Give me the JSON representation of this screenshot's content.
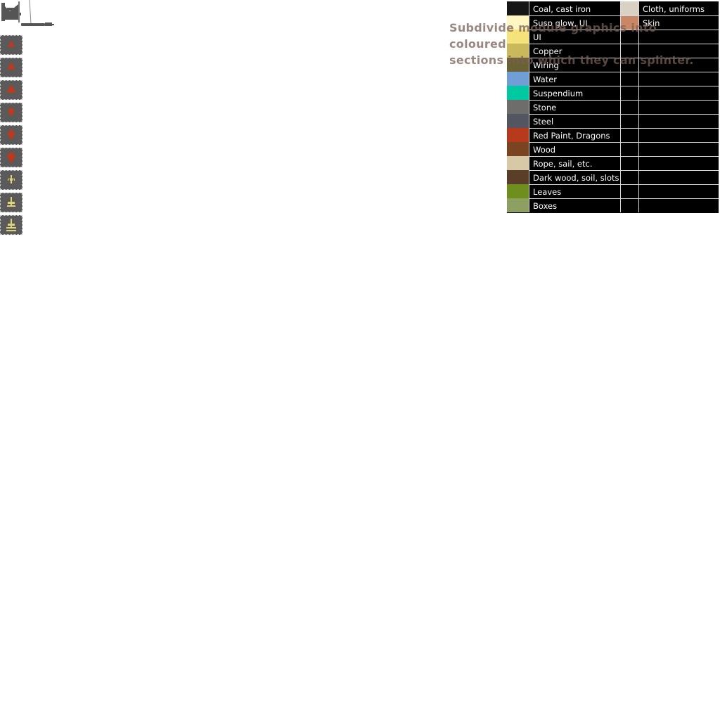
{
  "caption": {
    "line1": "Subdivide module graphics into coloured",
    "line2": "sections into which they can splinter."
  },
  "tools": [
    {
      "icon": "triangle-small-icon",
      "color": "#b83a20"
    },
    {
      "icon": "triangle-medium-icon",
      "color": "#b83a20"
    },
    {
      "icon": "triangle-large-icon",
      "color": "#b83a20"
    },
    {
      "icon": "blob-small-icon",
      "color": "#b83a20"
    },
    {
      "icon": "blob-medium-icon",
      "color": "#b83a20"
    },
    {
      "icon": "blob-large-icon",
      "color": "#b83a20"
    },
    {
      "icon": "splinter-small-icon",
      "color": "#e0d27a"
    },
    {
      "icon": "splinter-medium-icon",
      "color": "#e0d27a"
    },
    {
      "icon": "splinter-large-icon",
      "color": "#e0d27a"
    }
  ],
  "legend": {
    "left": [
      {
        "label": "Coal, cast iron",
        "color": "#161616"
      },
      {
        "label": "Susp glow, UI",
        "color": "#fff6c2"
      },
      {
        "label": "UI",
        "color": "#f5e27a"
      },
      {
        "label": "Copper",
        "color": "#c9b85c"
      },
      {
        "label": "Wiring",
        "color": "#6b6233"
      },
      {
        "label": "Water",
        "color": "#6f9fd6"
      },
      {
        "label": "Suspendium",
        "color": "#00c8a0"
      },
      {
        "label": "Stone",
        "color": "#6f6c6c"
      },
      {
        "label": "Steel",
        "color": "#535660"
      },
      {
        "label": "Red Paint, Dragons",
        "color": "#b83a1d"
      },
      {
        "label": "Wood",
        "color": "#7a4420"
      },
      {
        "label": "Rope, sail, etc.",
        "color": "#d8c9a6"
      },
      {
        "label": "Dark wood, soil, slots",
        "color": "#5b3e27"
      },
      {
        "label": "Leaves",
        "color": "#6e8f1e"
      },
      {
        "label": "Boxes",
        "color": "#8ea061"
      }
    ],
    "right": [
      {
        "label": "Cloth, uniforms",
        "color": "#d9d2c4"
      },
      {
        "label": "Skin",
        "color": "#c88866"
      }
    ]
  }
}
